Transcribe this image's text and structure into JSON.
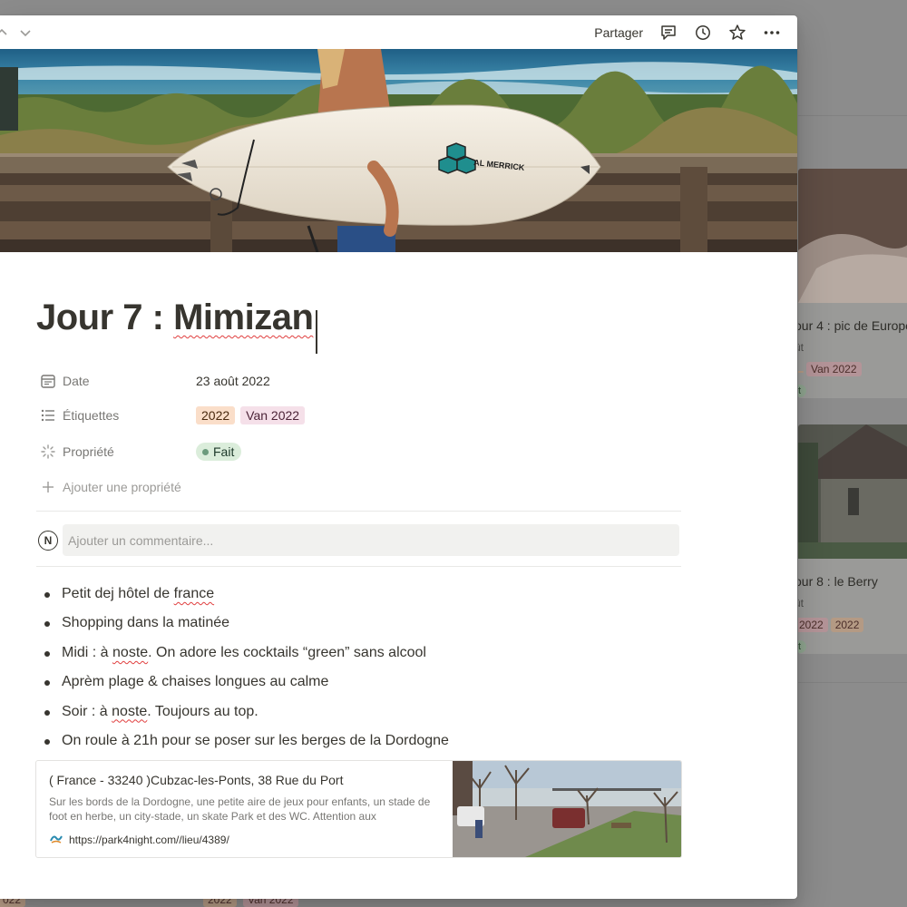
{
  "topbar": {
    "share_label": "Partager"
  },
  "page": {
    "title_prefix": "Jour 7 : ",
    "title_word": "Mimizan"
  },
  "properties": {
    "date": {
      "label": "Date",
      "value": "23 août 2022"
    },
    "tags": {
      "label": "Étiquettes",
      "items": [
        "2022",
        "Van 2022"
      ]
    },
    "status": {
      "label": "Propriété",
      "value": "Fait"
    },
    "add_label": "Ajouter une propriété"
  },
  "comment": {
    "avatar_letter": "N",
    "placeholder": "Ajouter un commentaire..."
  },
  "bullets": {
    "b1": {
      "pre": "Petit dej hôtel de ",
      "misspelled": "france",
      "post": ""
    },
    "b2": {
      "text": "Shopping dans la matinée"
    },
    "b3": {
      "pre": "Midi : à ",
      "misspelled": "noste",
      "post": ". On adore les cocktails “green” sans alcool"
    },
    "b4": {
      "text": "Aprèm plage & chaises longues au calme"
    },
    "b5": {
      "pre": "Soir : à ",
      "misspelled": "noste",
      "post": ". Toujours au top."
    },
    "b6": {
      "text": "On roule à 21h pour se poser sur les berges de la Dordogne"
    }
  },
  "bookmark": {
    "title": "( France - 33240 )Cubzac-les-Ponts, 38 Rue du Port",
    "description": "Sur les bords de la Dordogne, une petite aire de jeux pour enfants, un stade de foot en herbe, un city-stade, un skate Park et des WC. Attention aux",
    "url": "https://park4night.com//lieu/4389/"
  },
  "background_cards": {
    "card1": {
      "title": "our 4 : pic de Europe",
      "date": "ût",
      "tags": [
        "",
        "Van 2022"
      ],
      "status": "t"
    },
    "card2": {
      "title": "our 8 : le Berry",
      "date": "ût",
      "tags": [
        "2022",
        "2022"
      ],
      "status": "t"
    },
    "bottom_tags": [
      "022",
      "2022",
      "Van 2022"
    ]
  },
  "colors": {
    "tag_orange": "#fadec9",
    "tag_pink": "#f5e0e9",
    "status_green": "#dbeddb",
    "text": "#37352f",
    "muted": "#787774"
  }
}
